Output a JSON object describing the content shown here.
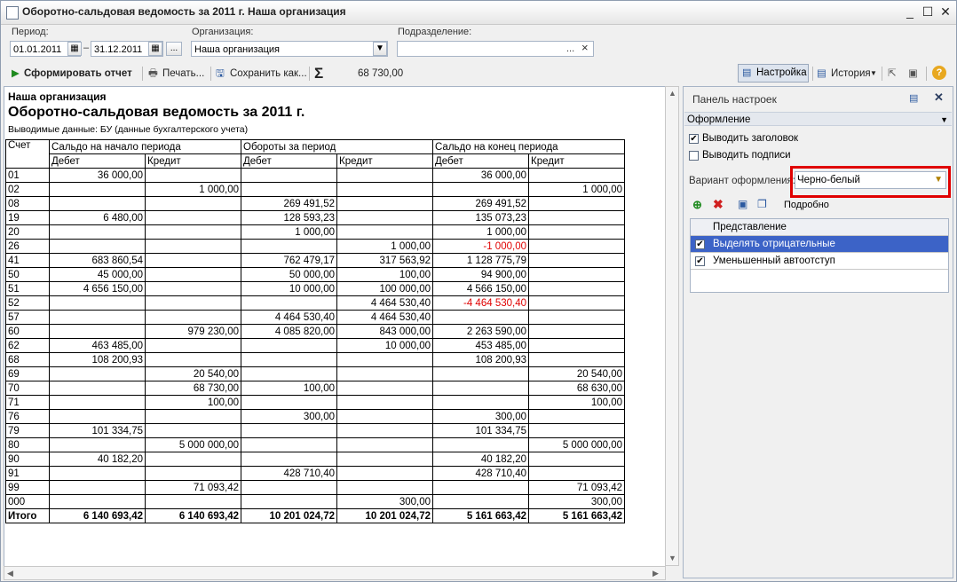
{
  "window": {
    "title": "Оборотно-сальдовая ведомость за 2011 г. Наша организация",
    "minimize": "_",
    "maximize": "☐",
    "close": "✕"
  },
  "filters": {
    "period_label": "Период:",
    "date_from": "01.01.2011",
    "dash": "–",
    "date_to": "31.12.2011",
    "ellipsis": "...",
    "org_label": "Организация:",
    "org_value": "Наша организация",
    "dept_label": "Подразделение:",
    "dept_value": "",
    "clear": "×"
  },
  "toolbar": {
    "generate": "Сформировать отчет",
    "print": "Печать...",
    "save": "Сохранить как...",
    "sum_value": "68 730,00",
    "settings": "Настройка",
    "history": "История",
    "help": "?"
  },
  "report": {
    "org": "Наша организация",
    "title": "Оборотно-сальдовая ведомость за 2011 г.",
    "subtitle": "Выводимые данные:  БУ (данные бухгалтерского учета)",
    "headers": {
      "account": "Счет",
      "opening": "Сальдо на начало периода",
      "turnover": "Обороты за период",
      "closing": "Сальдо на конец периода",
      "debit": "Дебет",
      "credit": "Кредит"
    },
    "rows": [
      [
        "01",
        "36 000,00",
        "",
        "",
        "",
        "36 000,00",
        ""
      ],
      [
        "02",
        "",
        "1 000,00",
        "",
        "",
        "",
        "1 000,00"
      ],
      [
        "08",
        "",
        "",
        "269 491,52",
        "",
        "269 491,52",
        ""
      ],
      [
        "19",
        "6 480,00",
        "",
        "128 593,23",
        "",
        "135 073,23",
        ""
      ],
      [
        "20",
        "",
        "",
        "1 000,00",
        "",
        "1 000,00",
        ""
      ],
      [
        "26",
        "",
        "",
        "",
        "1 000,00",
        "-1 000,00",
        ""
      ],
      [
        "41",
        "683 860,54",
        "",
        "762 479,17",
        "317 563,92",
        "1 128 775,79",
        ""
      ],
      [
        "50",
        "45 000,00",
        "",
        "50 000,00",
        "100,00",
        "94 900,00",
        ""
      ],
      [
        "51",
        "4 656 150,00",
        "",
        "10 000,00",
        "100 000,00",
        "4 566 150,00",
        ""
      ],
      [
        "52",
        "",
        "",
        "",
        "4 464 530,40",
        "-4 464 530,40",
        ""
      ],
      [
        "57",
        "",
        "",
        "4 464 530,40",
        "4 464 530,40",
        "",
        ""
      ],
      [
        "60",
        "",
        "979 230,00",
        "4 085 820,00",
        "843 000,00",
        "2 263 590,00",
        ""
      ],
      [
        "62",
        "463 485,00",
        "",
        "",
        "10 000,00",
        "453 485,00",
        ""
      ],
      [
        "68",
        "108 200,93",
        "",
        "",
        "",
        "108 200,93",
        ""
      ],
      [
        "69",
        "",
        "20 540,00",
        "",
        "",
        "",
        "20 540,00"
      ],
      [
        "70",
        "",
        "68 730,00",
        "100,00",
        "",
        "",
        "68 630,00"
      ],
      [
        "71",
        "",
        "100,00",
        "",
        "",
        "",
        "100,00"
      ],
      [
        "76",
        "",
        "",
        "300,00",
        "",
        "300,00",
        ""
      ],
      [
        "79",
        "101 334,75",
        "",
        "",
        "",
        "101 334,75",
        ""
      ],
      [
        "80",
        "",
        "5 000 000,00",
        "",
        "",
        "",
        "5 000 000,00"
      ],
      [
        "90",
        "40 182,20",
        "",
        "",
        "",
        "40 182,20",
        ""
      ],
      [
        "91",
        "",
        "",
        "428 710,40",
        "",
        "428 710,40",
        ""
      ],
      [
        "99",
        "",
        "71 093,42",
        "",
        "",
        "",
        "71 093,42"
      ],
      [
        "000",
        "",
        "",
        "",
        "300,00",
        "",
        "300,00"
      ]
    ],
    "total": [
      "Итого",
      "6 140 693,42",
      "6 140 693,42",
      "10 201 024,72",
      "10 201 024,72",
      "5 161 663,42",
      "5 161 663,42"
    ],
    "negative_color": "#e00000"
  },
  "panel": {
    "title": "Панель настроек",
    "section": "Оформление",
    "show_header": {
      "label": "Выводить заголовок",
      "checked": true
    },
    "show_signatures": {
      "label": "Выводить подписи",
      "checked": false
    },
    "variant_label": "Вариант оформления:",
    "variant_value": "Черно-белый",
    "details": "Подробно",
    "table_header": "Представление",
    "items": [
      {
        "label": "Выделять отрицательные",
        "checked": true,
        "selected": true
      },
      {
        "label": "Уменьшенный автоотступ",
        "checked": true,
        "selected": false
      }
    ],
    "selection_color": "#3c63c7"
  }
}
